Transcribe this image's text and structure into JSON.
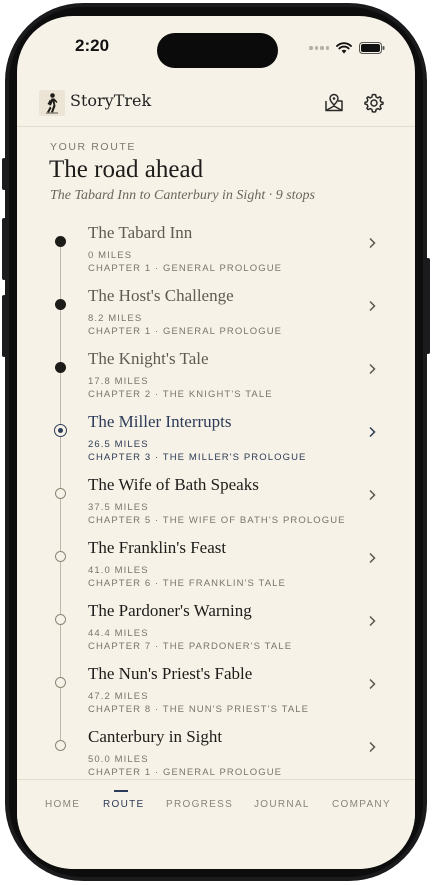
{
  "status": {
    "time": "2:20"
  },
  "app": {
    "name": "StoryTrek"
  },
  "route": {
    "eyebrow": "YOUR ROUTE",
    "title": "The road ahead",
    "subtitle": "The Tabard Inn to Canterbury in Sight · 9 stops"
  },
  "stops": [
    {
      "name": "The Tabard Inn",
      "miles": "0 MILES",
      "chapter": "CHAPTER 1 · GENERAL PROLOGUE",
      "state": "done"
    },
    {
      "name": "The Host's Challenge",
      "miles": "8.2 MILES",
      "chapter": "CHAPTER 1 · GENERAL PROLOGUE",
      "state": "done"
    },
    {
      "name": "The Knight's Tale",
      "miles": "17.8 MILES",
      "chapter": "CHAPTER 2 · THE KNIGHT'S TALE",
      "state": "done"
    },
    {
      "name": "The Miller Interrupts",
      "miles": "26.5 MILES",
      "chapter": "CHAPTER 3 · THE MILLER'S PROLOGUE",
      "state": "current"
    },
    {
      "name": "The Wife of Bath Speaks",
      "miles": "37.5 MILES",
      "chapter": "CHAPTER 5 · THE WIFE OF BATH'S PROLOGUE",
      "state": "future"
    },
    {
      "name": "The Franklin's Feast",
      "miles": "41.0 MILES",
      "chapter": "CHAPTER 6 · THE FRANKLIN'S TALE",
      "state": "future"
    },
    {
      "name": "The Pardoner's Warning",
      "miles": "44.4 MILES",
      "chapter": "CHAPTER 7 · THE PARDONER'S TALE",
      "state": "future"
    },
    {
      "name": "The Nun's Priest's Fable",
      "miles": "47.2 MILES",
      "chapter": "CHAPTER 8 · THE NUN'S PRIEST'S TALE",
      "state": "future"
    },
    {
      "name": "Canterbury in Sight",
      "miles": "50.0 MILES",
      "chapter": "CHAPTER 1 · GENERAL PROLOGUE",
      "state": "future"
    }
  ],
  "tabs": [
    {
      "label": "HOME",
      "active": false
    },
    {
      "label": "ROUTE",
      "active": true
    },
    {
      "label": "PROGRESS",
      "active": false
    },
    {
      "label": "JOURNAL",
      "active": false
    },
    {
      "label": "COMPANY",
      "active": false
    }
  ],
  "icons": {
    "logo": "walking-pilgrim-icon",
    "header_right": [
      "map-pin-icon",
      "gear-icon"
    ],
    "row": "chevron-right-icon"
  },
  "colors": {
    "background": "#f7f2e7",
    "accent": "#2c3b57",
    "ink": "#1d1c1a",
    "muted": "#7a746a"
  }
}
